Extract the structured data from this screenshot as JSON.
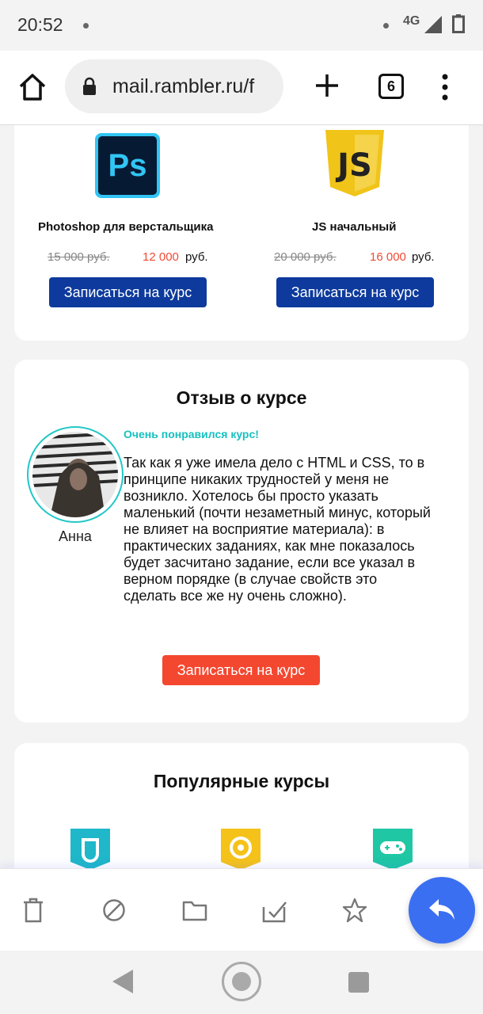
{
  "status_bar": {
    "time": "20:52",
    "network": "4G"
  },
  "browser": {
    "url": "mail.rambler.ru/f",
    "tab_count": "6"
  },
  "courses": [
    {
      "title": "Photoshop для верстальщика",
      "old_price": "15 000 руб.",
      "new_price": "12 000",
      "currency": "руб.",
      "button": "Записаться на курс",
      "icon": "photoshop-logo-icon",
      "logo_text": "Ps"
    },
    {
      "title": "JS начальный",
      "old_price": "20 000 руб.",
      "new_price": "16 000",
      "currency": "руб.",
      "button": "Записаться на курс",
      "icon": "javascript-logo-icon",
      "logo_text": "JS"
    }
  ],
  "review": {
    "title": "Отзыв о курсе",
    "author": "Анна",
    "headline": "Очень понравился курс!",
    "text": "Так как я уже имела дело с HTML и CSS, то в принципе никаких трудностей у меня не возникло. Хотелось бы просто указать маленький (почти незаметный минус, который не влияет на восприятие материала): в практических заданиях, как мне показалось будет засчитано задание, если все указал в верном порядке (в случае свойств это сделать все же ну очень сложно).",
    "button": "Записаться на курс"
  },
  "popular": {
    "title": "Популярные курсы",
    "icons": [
      "cyan-course-icon",
      "yellow-course-icon",
      "gamepad-course-icon"
    ]
  },
  "mail_toolbar": {
    "icons": [
      "trash-icon",
      "block-icon",
      "folder-icon",
      "mark-read-icon",
      "star-icon",
      "reply-icon"
    ]
  },
  "colors": {
    "accent_blue": "#0d3a9c",
    "price_red": "#f04a35",
    "teal": "#17c0c0",
    "cta_red": "#f4472f",
    "fab_blue": "#3b6ff2"
  }
}
